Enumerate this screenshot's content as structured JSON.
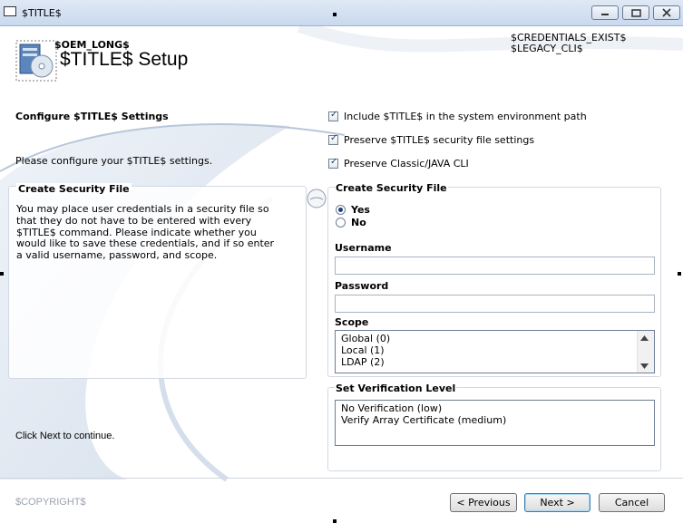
{
  "window": {
    "title": "$TITLE$"
  },
  "header": {
    "oem_long": "$OEM_LONG$",
    "title": "$TITLE$ Setup",
    "credentials_exist": "$CREDENTIALS_EXIST$",
    "legacy_cli": "$LEGACY_CLI$"
  },
  "left": {
    "heading": "Configure $TITLE$ Settings",
    "intro": "Please configure your $TITLE$ settings.",
    "security_heading": "Create Security File",
    "security_lines": [
      "You may place user credentials in a security file so",
      "that they do not have to be entered with every",
      "$TITLE$ command. Please indicate whether you",
      "would like to save these credentials, and if so enter",
      "a valid username, password, and scope."
    ],
    "click_next": "Click Next to continue."
  },
  "options": {
    "include_path": {
      "label": "Include $TITLE$ in the system environment path",
      "checked": true
    },
    "preserve_security": {
      "label": "Preserve $TITLE$ security file settings",
      "checked": true
    },
    "preserve_cli": {
      "label": "Preserve Classic/JAVA CLI",
      "checked": true
    }
  },
  "security": {
    "group_label": "Create Security File",
    "yes_label": "Yes",
    "no_label": "No",
    "selected": "Yes",
    "username_label": "Username",
    "username_value": "",
    "password_label": "Password",
    "password_value": "",
    "scope_label": "Scope",
    "scope_options": [
      "Global (0)",
      "Local (1)",
      "LDAP (2)"
    ]
  },
  "verification": {
    "group_label": "Set Verification Level",
    "options": [
      "No Verification (low)",
      "Verify Array Certificate (medium)"
    ]
  },
  "footer": {
    "copyright": "$COPYRIGHT$",
    "previous_label": "< Previous",
    "next_label": "Next >",
    "cancel_label": "Cancel"
  },
  "colors": {
    "accent": "#3c7fb1",
    "swoosh": "#c7d4e4",
    "titlebar": "#c9d9ee"
  }
}
